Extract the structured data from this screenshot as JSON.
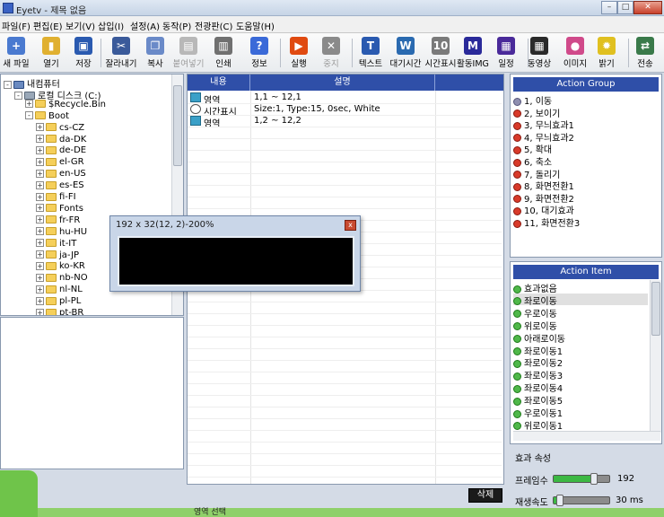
{
  "window": {
    "title": "Eyetv - 제목 없음",
    "min": "–",
    "max": "□",
    "close": "✕"
  },
  "menu": [
    "파일(F)",
    "편집(E)",
    "보기(V)",
    "삽입(I)",
    "설정(A)",
    "동작(P)",
    "전광판(C)",
    "도움말(H)"
  ],
  "toolbar": [
    {
      "label": "새 파일",
      "icon": "new-file-icon",
      "color": "#4a7ad0",
      "glyph": "+"
    },
    {
      "label": "열기",
      "icon": "open-folder-icon",
      "color": "#e0b030",
      "glyph": "▮"
    },
    {
      "label": "저장",
      "icon": "save-icon",
      "color": "#2a5ab0",
      "glyph": "▣"
    },
    {
      "label": "잘라내기",
      "icon": "cut-icon",
      "color": "#3a5a9a",
      "glyph": "✂"
    },
    {
      "label": "복사",
      "icon": "copy-icon",
      "color": "#6a8ac8",
      "glyph": "❐"
    },
    {
      "label": "붙여넣기",
      "icon": "paste-icon",
      "color": "#b8b8b8",
      "glyph": "▤"
    },
    {
      "label": "인쇄",
      "icon": "print-icon",
      "color": "#707070",
      "glyph": "▥"
    },
    {
      "label": "정보",
      "icon": "info-icon",
      "color": "#3a6ad8",
      "glyph": "?"
    },
    {
      "label": "실행",
      "icon": "run-icon",
      "color": "#e04a10",
      "glyph": "▶"
    },
    {
      "label": "중지",
      "icon": "stop-icon",
      "color": "#8a8a8a",
      "glyph": "✕"
    },
    {
      "label": "텍스트",
      "icon": "text-icon",
      "color": "#2a5ab0",
      "glyph": "T"
    },
    {
      "label": "대기시간",
      "icon": "wait-time-icon",
      "color": "#2a6ab0",
      "glyph": "W"
    },
    {
      "label": "시간표시",
      "icon": "time-display-icon",
      "color": "#7a7a7a",
      "glyph": "10"
    },
    {
      "label": "활동IMG",
      "icon": "activity-img-icon",
      "color": "#2a2a9a",
      "glyph": "M"
    },
    {
      "label": "일정",
      "icon": "schedule-icon",
      "color": "#4a2a9a",
      "glyph": "▦"
    },
    {
      "label": "동영상",
      "icon": "video-icon",
      "color": "#2a2a2a",
      "glyph": "▦"
    },
    {
      "label": "이미지",
      "icon": "image-icon",
      "color": "#d04a8a",
      "glyph": "●"
    },
    {
      "label": "밝기",
      "icon": "brightness-icon",
      "color": "#e0c020",
      "glyph": "✹"
    },
    {
      "label": "전송",
      "icon": "transfer-icon",
      "color": "#3a7a4a",
      "glyph": "⇄"
    }
  ],
  "tree": [
    {
      "label": "내컴퓨터",
      "level": 0,
      "expander": "-",
      "icon": "computer-icon"
    },
    {
      "label": "로컬 디스크 (C:)",
      "level": 1,
      "expander": "-",
      "icon": "disk-icon"
    },
    {
      "label": "$Recycle.Bin",
      "level": 2,
      "expander": "+",
      "icon": "folder-icon"
    },
    {
      "label": "Boot",
      "level": 2,
      "expander": "-",
      "icon": "folder-icon"
    },
    {
      "label": "cs-CZ",
      "level": 3,
      "expander": "+",
      "icon": "folder-icon"
    },
    {
      "label": "da-DK",
      "level": 3,
      "expander": "+",
      "icon": "folder-icon"
    },
    {
      "label": "de-DE",
      "level": 3,
      "expander": "+",
      "icon": "folder-icon"
    },
    {
      "label": "el-GR",
      "level": 3,
      "expander": "+",
      "icon": "folder-icon"
    },
    {
      "label": "en-US",
      "level": 3,
      "expander": "+",
      "icon": "folder-icon"
    },
    {
      "label": "es-ES",
      "level": 3,
      "expander": "+",
      "icon": "folder-icon"
    },
    {
      "label": "fi-FI",
      "level": 3,
      "expander": "+",
      "icon": "folder-icon"
    },
    {
      "label": "Fonts",
      "level": 3,
      "expander": "+",
      "icon": "folder-icon"
    },
    {
      "label": "fr-FR",
      "level": 3,
      "expander": "+",
      "icon": "folder-icon"
    },
    {
      "label": "hu-HU",
      "level": 3,
      "expander": "+",
      "icon": "folder-icon"
    },
    {
      "label": "it-IT",
      "level": 3,
      "expander": "+",
      "icon": "folder-icon"
    },
    {
      "label": "ja-JP",
      "level": 3,
      "expander": "+",
      "icon": "folder-icon"
    },
    {
      "label": "ko-KR",
      "level": 3,
      "expander": "+",
      "icon": "folder-icon"
    },
    {
      "label": "nb-NO",
      "level": 3,
      "expander": "+",
      "icon": "folder-icon"
    },
    {
      "label": "nl-NL",
      "level": 3,
      "expander": "+",
      "icon": "folder-icon"
    },
    {
      "label": "pl-PL",
      "level": 3,
      "expander": "+",
      "icon": "folder-icon"
    },
    {
      "label": "pt-BR",
      "level": 3,
      "expander": "+",
      "icon": "folder-icon"
    }
  ],
  "content": {
    "headers": [
      "내용",
      "설명"
    ],
    "rows": [
      {
        "name": "영역",
        "desc": "1,1 ~ 12,1",
        "icon": "area-icon"
      },
      {
        "name": "시간표시",
        "desc": "Size:1, Type:15, 0sec, White",
        "icon": "clock-icon"
      },
      {
        "name": "영역",
        "desc": "1,2 ~ 12,2",
        "icon": "area-icon"
      }
    ]
  },
  "dialog": {
    "title": "192 x 32(12, 2)-200%",
    "close": "x"
  },
  "action_group": {
    "title": "Action Group",
    "items": [
      {
        "label": "1, 이동",
        "dot": "gray"
      },
      {
        "label": "2, 보이기",
        "dot": "red"
      },
      {
        "label": "3, 무늬효과1",
        "dot": "red"
      },
      {
        "label": "4, 무늬효과2",
        "dot": "red"
      },
      {
        "label": "5, 확대",
        "dot": "red"
      },
      {
        "label": "6, 축소",
        "dot": "red"
      },
      {
        "label": "7, 돌리기",
        "dot": "red"
      },
      {
        "label": "8, 화면전환1",
        "dot": "red"
      },
      {
        "label": "9, 화면전환2",
        "dot": "red"
      },
      {
        "label": "10, 대기효과",
        "dot": "red"
      },
      {
        "label": "11, 화면전환3",
        "dot": "red"
      }
    ]
  },
  "action_item": {
    "title": "Action Item",
    "items": [
      {
        "label": "효과없음",
        "dot": "green"
      },
      {
        "label": "좌로이동",
        "dot": "green",
        "selected": true
      },
      {
        "label": "우로이동",
        "dot": "green"
      },
      {
        "label": "위로이동",
        "dot": "green"
      },
      {
        "label": "아래로이동",
        "dot": "green"
      },
      {
        "label": "좌로이동1",
        "dot": "green"
      },
      {
        "label": "좌로이동2",
        "dot": "green"
      },
      {
        "label": "좌로이동3",
        "dot": "green"
      },
      {
        "label": "좌로이동4",
        "dot": "green"
      },
      {
        "label": "좌로이동5",
        "dot": "green"
      },
      {
        "label": "우로이동1",
        "dot": "green"
      },
      {
        "label": "위로이동1",
        "dot": "green"
      }
    ]
  },
  "effect_props": {
    "title": "효과 속성",
    "frame_label": "프레임수",
    "frame_value": "192",
    "frame_level": 0.72,
    "speed_label": "재생속도",
    "speed_value": "30 ms",
    "speed_level": 0.12
  },
  "delete_button": "삭제",
  "selection_label": "영역 선택"
}
